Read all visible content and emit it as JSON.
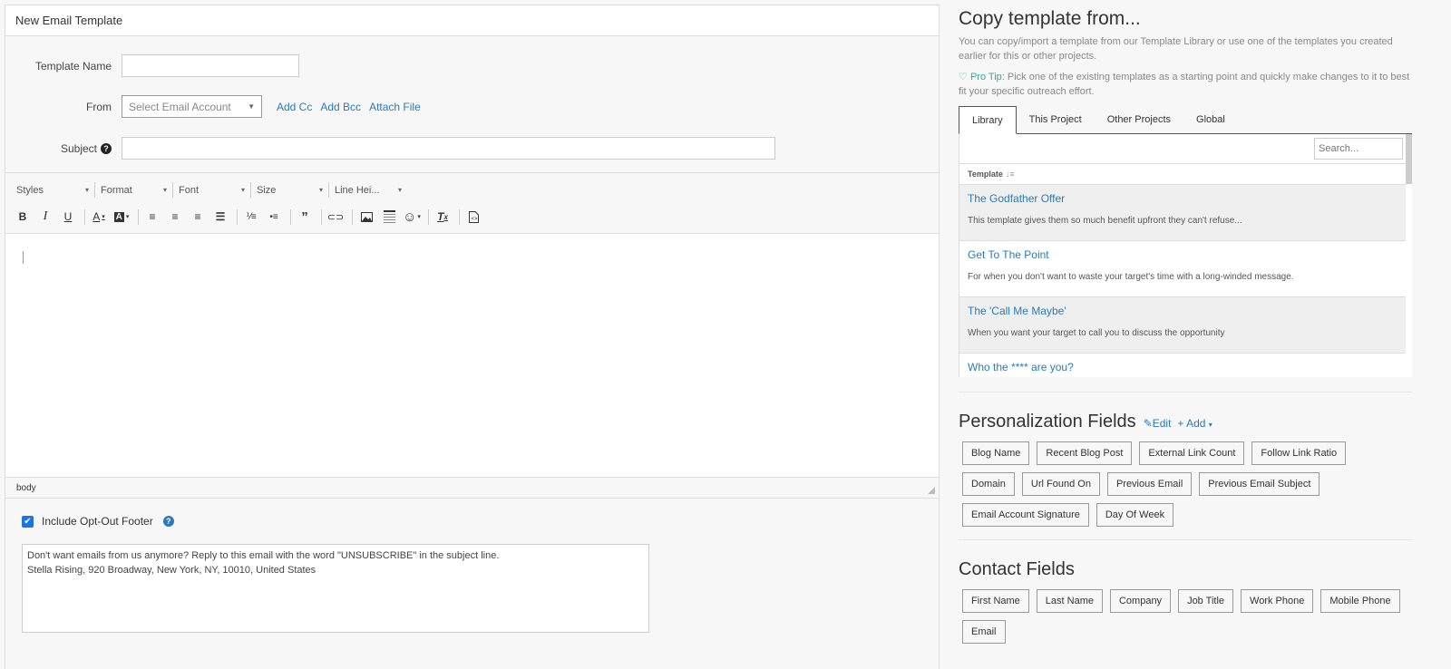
{
  "left": {
    "header_title": "New Email Template",
    "form": {
      "template_name_label": "Template Name",
      "template_name_value": "",
      "from_label": "From",
      "from_placeholder": "Select Email Account",
      "add_cc": "Add Cc",
      "add_bcc": "Add Bcc",
      "attach_file": "Attach File",
      "subject_label": "Subject",
      "subject_value": ""
    },
    "toolbar": {
      "combos": [
        "Styles",
        "Format",
        "Font",
        "Size",
        "Line Hei..."
      ],
      "buttons": [
        "bold",
        "italic",
        "underline",
        "text-color",
        "background-color",
        "align-left",
        "align-center",
        "align-right",
        "justify",
        "numbered-list",
        "bulleted-list",
        "blockquote",
        "link",
        "image",
        "horizontal-line",
        "emoji",
        "remove-format",
        "source"
      ]
    },
    "editor_content": "",
    "status_path": "body",
    "optout": {
      "checked": true,
      "label": "Include Opt-Out Footer",
      "footer_text_line1": "Don't want emails from us anymore? Reply to this email with the word \"UNSUBSCRIBE\" in the subject line.",
      "footer_text_line2": "Stella Rising, 920 Broadway, New York, NY, 10010, United States"
    }
  },
  "right": {
    "title": "Copy template from...",
    "description": "You can copy/import a template from our Template Library or use one of the templates you created earlier for this or other projects.",
    "pro_tip_label": "Pro Tip:",
    "pro_tip_text": " Pick one of the existing templates as a starting point and quickly make changes to it to best fit your specific outreach effort.",
    "tabs": [
      {
        "label": "Library",
        "active": true
      },
      {
        "label": "This Project",
        "active": false
      },
      {
        "label": "Other Projects",
        "active": false
      },
      {
        "label": "Global",
        "active": false
      }
    ],
    "search_placeholder": "Search...",
    "list_header": "Template",
    "templates": [
      {
        "title": "The Godfather Offer",
        "desc": "This template gives them so much benefit upfront they can't refuse..."
      },
      {
        "title": "Get To The Point",
        "desc": "For when you don't want to waste your target's time with a long-winded message."
      },
      {
        "title": "The 'Call Me Maybe'",
        "desc": "When you want your target to call you to discuss the opportunity"
      },
      {
        "title": "Who the **** are you?",
        "desc": ""
      }
    ],
    "personalization": {
      "title": "Personalization Fields",
      "edit_label": "Edit",
      "add_label": "Add",
      "fields": [
        "Blog Name",
        "Recent Blog Post",
        "External Link Count",
        "Follow Link Ratio",
        "Domain",
        "Url Found On",
        "Previous Email",
        "Previous Email Subject",
        "Email Account Signature",
        "Day Of Week"
      ]
    },
    "contact": {
      "title": "Contact Fields",
      "fields": [
        "First Name",
        "Last Name",
        "Company",
        "Job Title",
        "Work Phone",
        "Mobile Phone",
        "Email"
      ]
    }
  }
}
